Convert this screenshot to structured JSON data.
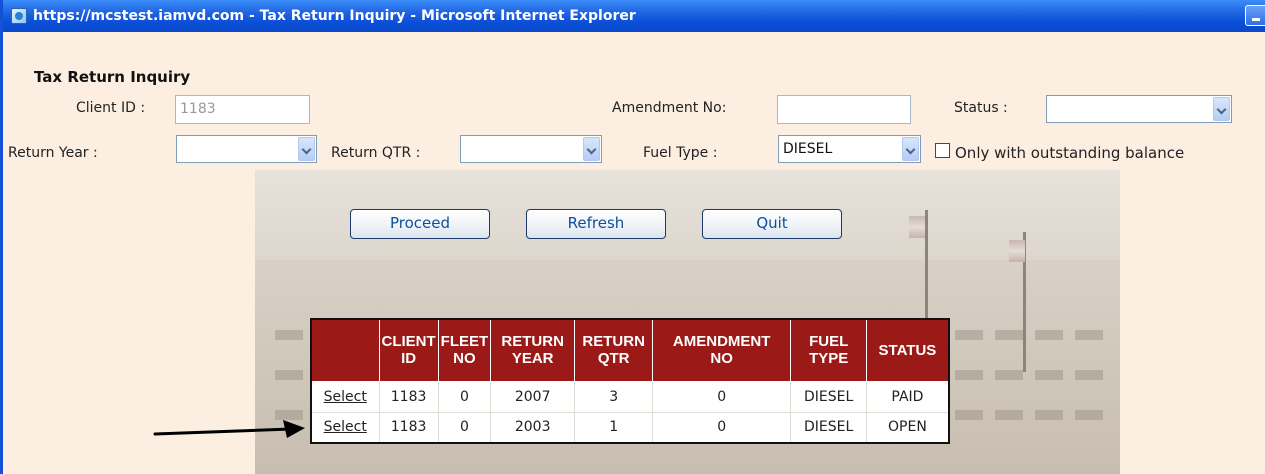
{
  "window": {
    "title": "https://mcstest.iamvd.com - Tax Return Inquiry - Microsoft Internet Explorer"
  },
  "form": {
    "title": "Tax Return Inquiry",
    "client_id": {
      "label": "Client ID :",
      "value": "1183"
    },
    "amendment_no": {
      "label": "Amendment No:",
      "value": ""
    },
    "status": {
      "label": "Status :",
      "value": ""
    },
    "return_year": {
      "label": "Return Year :",
      "value": ""
    },
    "return_qtr": {
      "label": "Return QTR :",
      "value": ""
    },
    "fuel_type": {
      "label": "Fuel Type :",
      "value": "DIESEL"
    },
    "outstanding": {
      "label": "Only with outstanding balance",
      "checked": false
    }
  },
  "buttons": {
    "proceed": "Proceed",
    "refresh": "Refresh",
    "quit": "Quit"
  },
  "table": {
    "headers": [
      {
        "line1": "",
        "line2": ""
      },
      {
        "line1": "CLIENT",
        "line2": "ID"
      },
      {
        "line1": "FLEET",
        "line2": "NO"
      },
      {
        "line1": "RETURN",
        "line2": "YEAR"
      },
      {
        "line1": "RETURN",
        "line2": "QTR"
      },
      {
        "line1": "AMENDMENT",
        "line2": "NO"
      },
      {
        "line1": "FUEL",
        "line2": "TYPE"
      },
      {
        "line1": "STATUS",
        "line2": ""
      }
    ],
    "rows": [
      {
        "action": "Select",
        "client_id": "1183",
        "fleet_no": "0",
        "return_year": "2007",
        "return_qtr": "3",
        "amendment_no": "0",
        "fuel_type": "DIESEL",
        "status": "PAID"
      },
      {
        "action": "Select",
        "client_id": "1183",
        "fleet_no": "0",
        "return_year": "2003",
        "return_qtr": "1",
        "amendment_no": "0",
        "fuel_type": "DIESEL",
        "status": "OPEN"
      }
    ]
  },
  "colors": {
    "titlebar": "#0a4fd8",
    "page_background": "#fcefe2",
    "table_header": "#9b1a17",
    "button_text": "#0e4f9c"
  },
  "icons": {
    "window_icon": "ie-page-icon",
    "minimize": "minimize-icon",
    "dropdown": "chevron-down-icon",
    "pointer": "arrow-right-icon"
  }
}
